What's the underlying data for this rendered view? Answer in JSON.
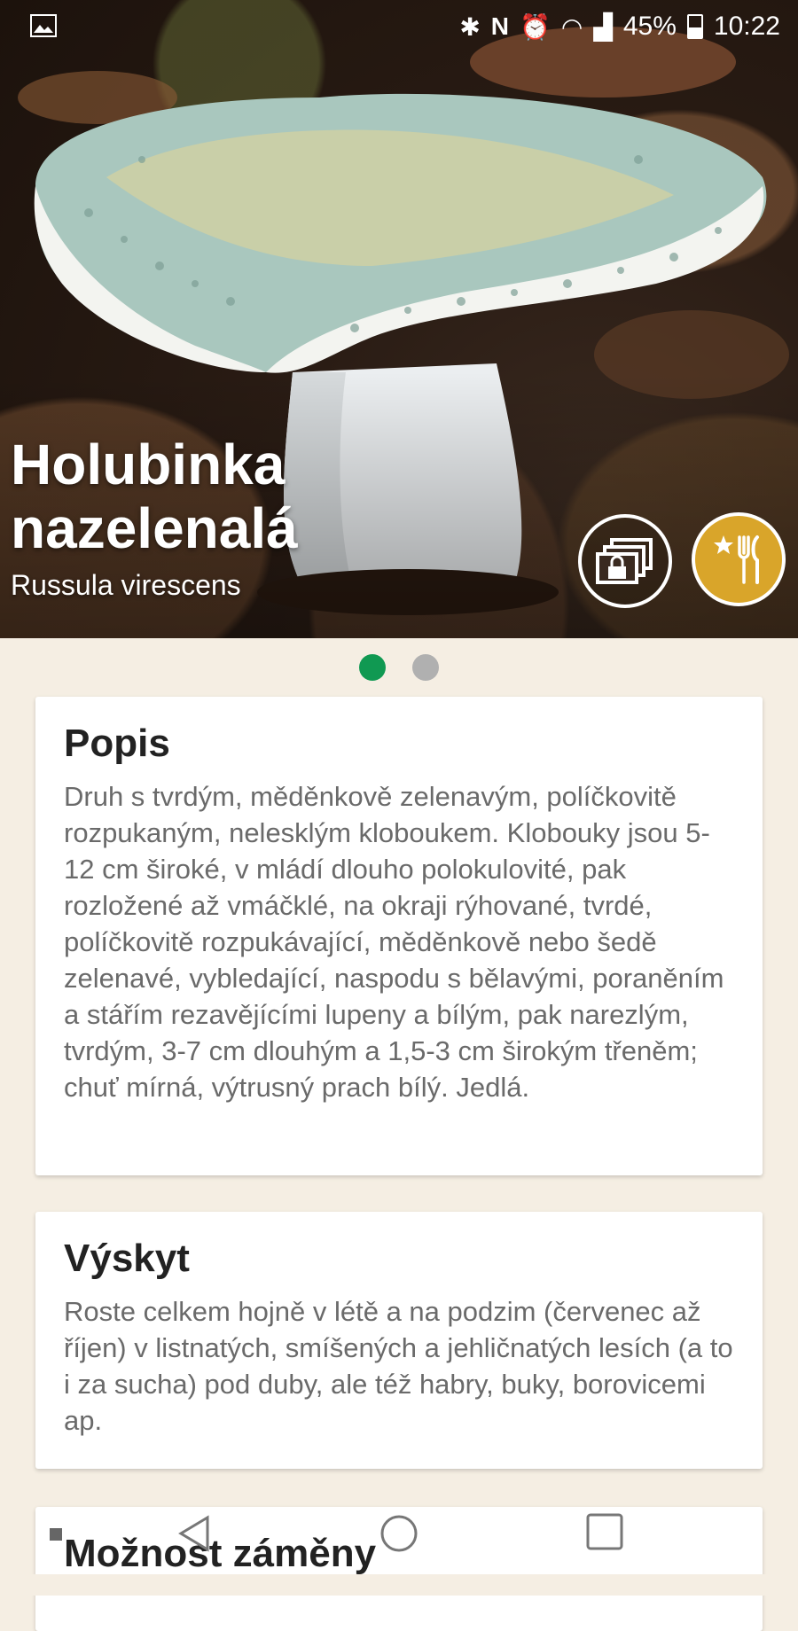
{
  "status_bar": {
    "battery_percent": "45%",
    "time": "10:22",
    "icons": [
      "gallery-icon",
      "bluetooth-icon",
      "nfc-icon",
      "alarm-icon",
      "wifi-icon",
      "signal-icon",
      "battery-icon"
    ]
  },
  "hero": {
    "title": "Holubinka nazelenalá",
    "subtitle": "Russula virescens",
    "gallery_button_icon": "image-stack-lock-icon",
    "edible_button_icon": "star-fork-knife-icon",
    "edible_color": "#d9a52a"
  },
  "pager": {
    "pages": 2,
    "active_index": 0,
    "active_color": "#109952"
  },
  "sections": [
    {
      "heading": "Popis",
      "text": "Druh s tvrdým, měděnkově zelenavým, políčkovitě rozpukaným, nelesklým kloboukem. Klobouky jsou 5-12 cm široké, v mládí dlouho polokulovité, pak rozložené až vmáčklé, na okraji rýhované, tvrdé, políčkovitě rozpukávající, měděnkově nebo šedě zelenavé, vybledající, naspodu s bělavými, poraněním a stářím rezavějícími lupeny a bílým, pak narezlým, tvrdým, 3-7 cm dlouhým a 1,5-3 cm širokým třeněm; chuť mírná, výtrusný prach bílý. Jedlá."
    },
    {
      "heading": "Výskyt",
      "text": "Roste celkem hojně v létě a na podzim (červenec až říjen) v listnatých, smíšených a jehličnatých lesích (a to i za sucha) pod duby, ale též habry, buky, borovicemi ap."
    },
    {
      "heading": "Možnost záměny",
      "text": ""
    }
  ],
  "navbar": {
    "icons": [
      "back-icon",
      "home-icon",
      "recents-icon"
    ]
  }
}
